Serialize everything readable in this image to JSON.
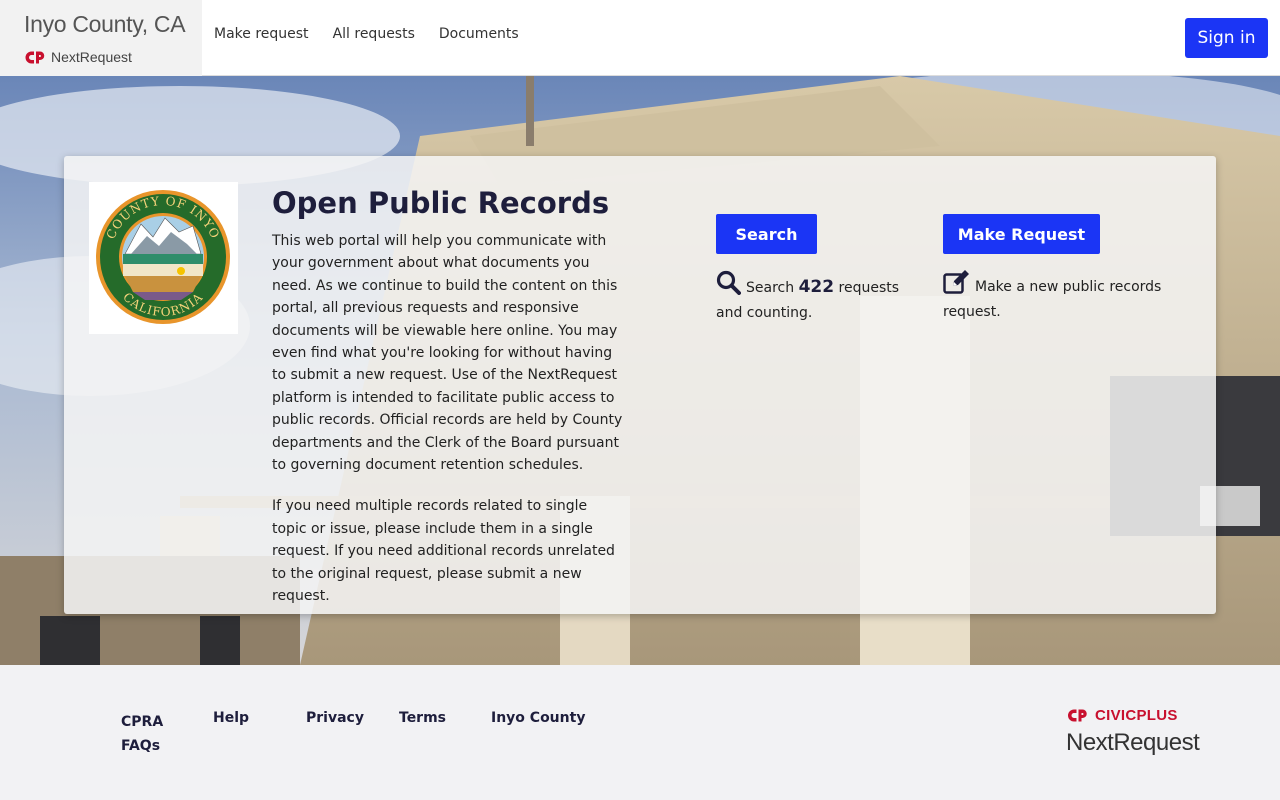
{
  "header": {
    "agency_name": "Inyo County, CA",
    "platform_name": "NextRequest",
    "nav": [
      "Make request",
      "All requests",
      "Documents"
    ],
    "sign_in_label": "Sign in"
  },
  "hero": {
    "title": "Open Public Records",
    "description": [
      "This web portal will help you communicate with your government about what documents you need. As we continue to build the content on this portal, all previous requests and responsive documents will be viewable here online. You may even find what you're looking for without having to submit a new request. Use of the NextRequest platform is intended to facilitate public access to public records. Official records are held by County departments and the Clerk of the Board pursuant to governing document retention schedules.",
      "If you need multiple records related to single topic or issue, please include them in a single request. If you need additional records unrelated to the original request, please submit a new request."
    ],
    "seal": {
      "top_text": "COUNTY OF INYO",
      "bottom_text": "CALIFORNIA"
    },
    "search": {
      "button_label": "Search",
      "icon": "search-icon",
      "text_before": "Search",
      "count": "422",
      "text_after": "requests and counting."
    },
    "make_request": {
      "button_label": "Make Request",
      "icon": "edit-icon",
      "text": "Make a new public records request."
    }
  },
  "footer": {
    "links": [
      "CPRA FAQs",
      "Help",
      "Privacy",
      "Terms",
      "Inyo County"
    ],
    "brand_top": "CIVICPLUS",
    "brand_bottom": "NextRequest"
  },
  "colors": {
    "primary": "#1b35f5",
    "heading": "#1e1e3c",
    "civicplus_red": "#c8102e"
  }
}
